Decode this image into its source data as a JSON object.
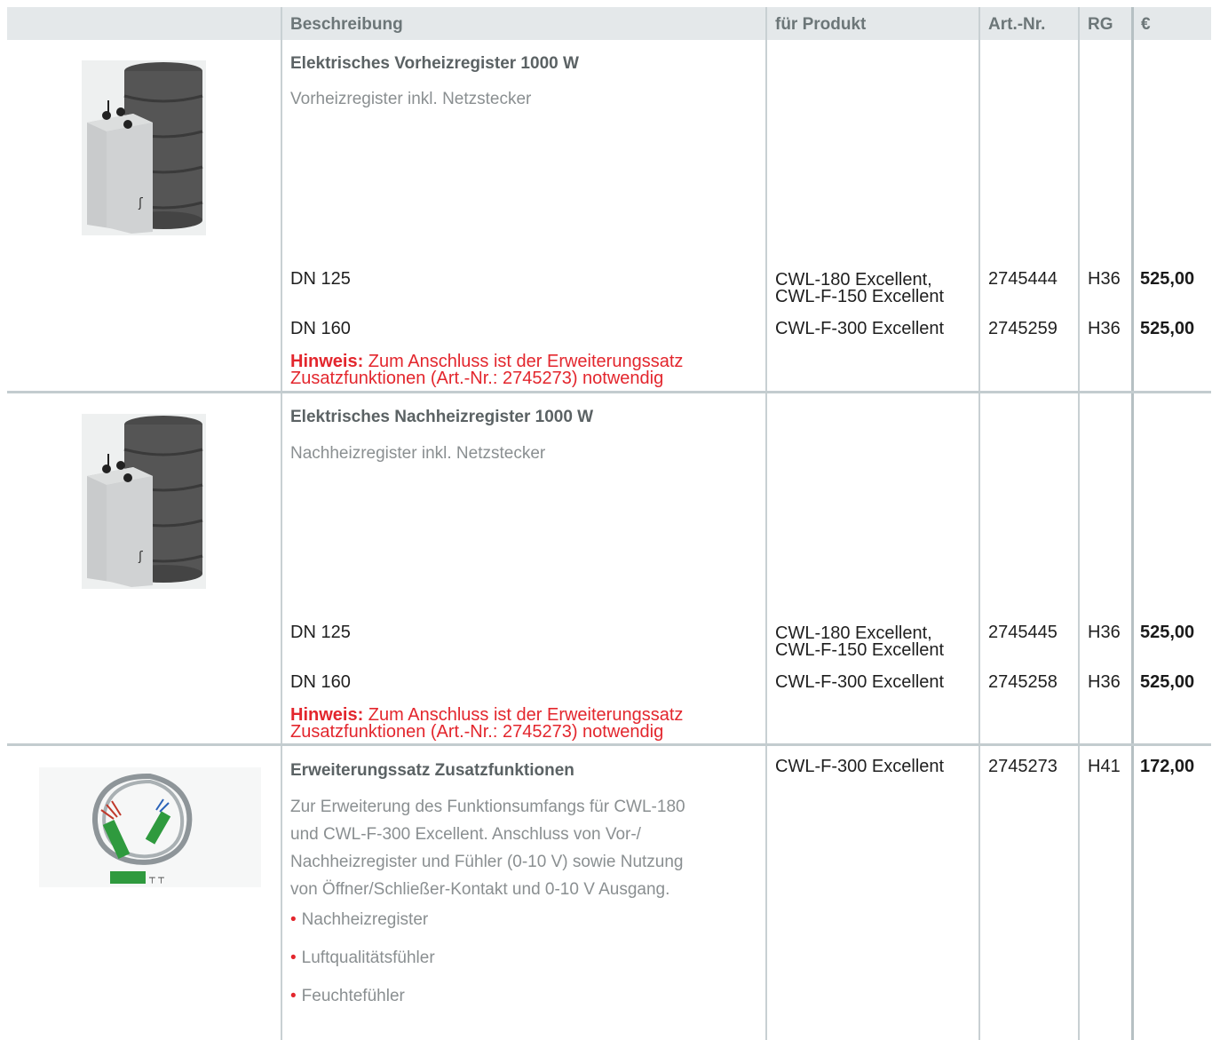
{
  "header": {
    "beschreibung": "Beschreibung",
    "fuer_produkt": "für Produkt",
    "art_nr": "Art.-Nr.",
    "rg": "RG",
    "euro": "€"
  },
  "products": [
    {
      "image_icon": "preheater-product-image",
      "title": "Elektrisches Vorheizregister 1000 W",
      "description": "Vorheizregister inkl. Netzstecker",
      "variants": [
        {
          "size": "DN 125",
          "product_line1": "CWL-180 Excellent,",
          "product_line2": "CWL-F-150 Excellent",
          "art_nr": "2745444",
          "rg": "H36",
          "price": "525,00"
        },
        {
          "size": "DN 160",
          "product_line1": "CWL-F-300 Excellent",
          "product_line2": "",
          "art_nr": "2745259",
          "rg": "H36",
          "price": "525,00"
        }
      ],
      "hint_label": "Hinweis:",
      "hint_line1": " Zum Anschluss ist der Erweiterungssatz",
      "hint_line2": "Zusatzfunktionen (Art.-Nr.: 2745273) notwendig"
    },
    {
      "image_icon": "reheater-product-image",
      "title": "Elektrisches Nachheizregister 1000 W",
      "description": "Nachheizregister inkl. Netzstecker",
      "variants": [
        {
          "size": "DN 125",
          "product_line1": "CWL-180 Excellent,",
          "product_line2": "CWL-F-150 Excellent",
          "art_nr": "2745445",
          "rg": "H36",
          "price": "525,00"
        },
        {
          "size": "DN 160",
          "product_line1": "CWL-F-300 Excellent",
          "product_line2": "",
          "art_nr": "2745258",
          "rg": "H36",
          "price": "525,00"
        }
      ],
      "hint_label": "Hinweis:",
      "hint_line1": " Zum Anschluss ist der Erweiterungssatz",
      "hint_line2": "Zusatzfunktionen (Art.-Nr.: 2745273) notwendig"
    },
    {
      "image_icon": "cable-set-product-image",
      "title": "Erweiterungssatz Zusatzfunktionen",
      "product": "CWL-F-300 Excellent",
      "art_nr": "2745273",
      "rg": "H41",
      "price": "172,00",
      "paragraph": [
        "Zur Erweiterung des Funktionsumfangs für CWL-180",
        "und CWL-F-300 Excellent. Anschluss von Vor-/",
        "Nachheizregister und Fühler (0-10 V) sowie Nutzung",
        "von Öffner/Schließer-Kontakt und 0-10 V Ausgang."
      ],
      "bullets": [
        "Nachheizregister",
        "Luftqualitätsfühler",
        "Feuchtefühler"
      ]
    }
  ],
  "colors": {
    "header_bg": "#e4e8ea",
    "header_text": "#6c7678",
    "accent_red": "#e3262d",
    "grid_line": "#c8d0d3"
  }
}
